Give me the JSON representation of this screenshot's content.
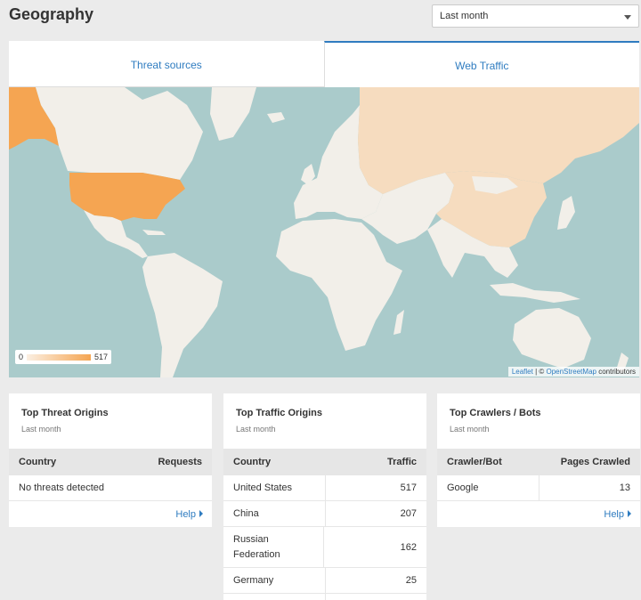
{
  "header": {
    "title": "Geography"
  },
  "range_select": {
    "value": "Last month"
  },
  "tabs": [
    {
      "label": "Threat sources",
      "active": false
    },
    {
      "label": "Web Traffic",
      "active": true
    }
  ],
  "map": {
    "legend_min": "0",
    "legend_max": "517",
    "attribution": {
      "leaflet": "Leaflet",
      "sep": " | © ",
      "osm": "OpenStreetMap",
      "suffix": " contributors"
    },
    "colors": {
      "water": "#aacbcb",
      "land": "#f2efe9",
      "high": "#f5a552",
      "mid": "#f6dcbf"
    }
  },
  "threat_origins": {
    "title": "Top Threat Origins",
    "subtitle": "Last month",
    "col1": "Country",
    "col2": "Requests",
    "empty": "No threats detected",
    "help": "Help"
  },
  "traffic_origins": {
    "title": "Top Traffic Origins",
    "subtitle": "Last month",
    "col1": "Country",
    "col2": "Traffic",
    "rows": [
      {
        "country": "United States",
        "value": "517"
      },
      {
        "country": "China",
        "value": "207"
      },
      {
        "country": "Russian Federation",
        "value": "162"
      },
      {
        "country": "Germany",
        "value": "25"
      }
    ]
  },
  "crawlers": {
    "title": "Top Crawlers / Bots",
    "subtitle": "Last month",
    "col1": "Crawler/Bot",
    "col2": "Pages Crawled",
    "rows": [
      {
        "name": "Google",
        "value": "13"
      }
    ],
    "help": "Help"
  }
}
